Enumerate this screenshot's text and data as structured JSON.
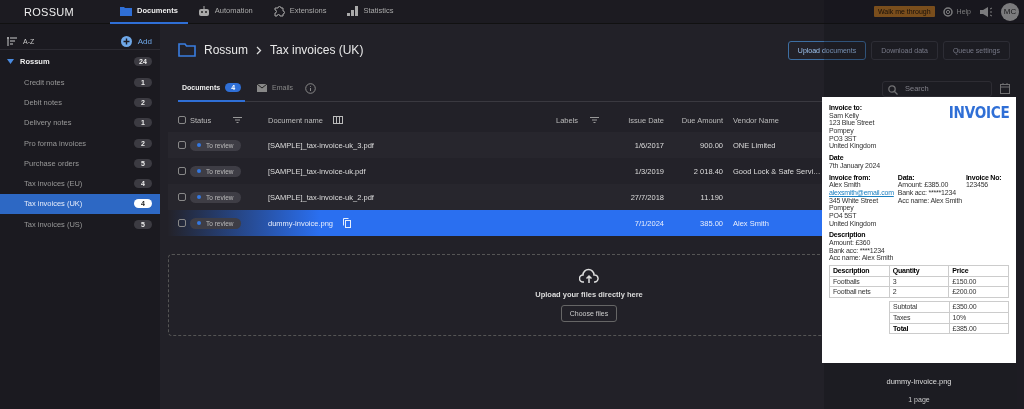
{
  "topbar": {
    "logo": "ROSSUM",
    "nav": [
      {
        "label": "Documents",
        "selected": true
      },
      {
        "label": "Automation",
        "selected": false
      },
      {
        "label": "Extensions",
        "selected": false
      },
      {
        "label": "Statistics",
        "selected": false
      }
    ],
    "walkthrough": "Walk me through",
    "help": "Help",
    "avatar": "MC"
  },
  "sidebar": {
    "sort": "A-Z",
    "add": "Add",
    "workspace": {
      "name": "Rossum",
      "count": "24",
      "expanded": true,
      "children": [
        {
          "label": "Credit notes",
          "count": "1",
          "selected": false
        },
        {
          "label": "Debit notes",
          "count": "2",
          "selected": false
        },
        {
          "label": "Delivery notes",
          "count": "1",
          "selected": false
        },
        {
          "label": "Pro forma invoices",
          "count": "2",
          "selected": false
        },
        {
          "label": "Purchase orders",
          "count": "5",
          "selected": false
        },
        {
          "label": "Tax invoices (EU)",
          "count": "4",
          "selected": false
        },
        {
          "label": "Tax invoices (UK)",
          "count": "4",
          "selected": true
        },
        {
          "label": "Tax invoices (US)",
          "count": "5",
          "selected": false
        }
      ]
    }
  },
  "header": {
    "breadcrumb": [
      "Rossum",
      "Tax invoices (UK)"
    ],
    "buttons": [
      {
        "label": "Upload documents",
        "kind": "primary"
      },
      {
        "label": "Download data",
        "kind": "secondary"
      },
      {
        "label": "Queue settings",
        "kind": "secondary"
      }
    ]
  },
  "tabs": [
    {
      "label": "Documents",
      "badge": "4",
      "selected": true
    },
    {
      "label": "Emails",
      "selected": false
    }
  ],
  "search": {
    "placeholder": "Search"
  },
  "table": {
    "all_checked": false,
    "columns": [
      "Status",
      "Document name",
      "Labels",
      "Issue Date",
      "Due Amount",
      "Vendor Name"
    ],
    "rows": [
      {
        "status": "To review",
        "name": "[SAMPLE]_tax-invoice-uk_3.pdf",
        "issue_date": "1/6/2017",
        "due_amount": "900.00",
        "vendor": "ONE Limited",
        "checked": false,
        "selected": false
      },
      {
        "status": "To review",
        "name": "[SAMPLE]_tax-invoice-uk.pdf",
        "issue_date": "1/3/2019",
        "due_amount": "2 018.40",
        "vendor": "Good Lock & Safe Servi…",
        "checked": false,
        "selected": false
      },
      {
        "status": "To review",
        "name": "[SAMPLE]_tax-invoice-uk_2.pdf",
        "issue_date": "27/7/2018",
        "due_amount": "11.190",
        "checked": false,
        "selected": false
      },
      {
        "status": "To review",
        "name": "dummy-invoice.png",
        "issue_date": "7/1/2024",
        "due_amount": "385.00",
        "vendor": "Alex Smith",
        "checked": false,
        "selected": true
      }
    ]
  },
  "upload": {
    "text": "Upload your files directly here",
    "button": "Choose files"
  },
  "preview": {
    "filename": "dummy-invoice.png",
    "pages": "1 page",
    "document": {
      "title": "INVOICE",
      "to": [
        "Invoice to:",
        "Sam Kelly",
        "123 Blue Street",
        "Pompey",
        "PO3 3ST",
        "United Kingdom"
      ],
      "date": [
        "Date",
        "7th January 2024"
      ],
      "from": [
        "Invoice from:",
        "Alex Smith",
        "alexsmith@email.com",
        "345 White Street",
        "Pompey",
        "PO4 5ST",
        "United Kingdom"
      ],
      "data": [
        "Data:",
        "Amount: £385.00",
        "Bank acc: *****1234",
        "Acc name: Alex Smith"
      ],
      "number": [
        "Invoice No:",
        "123456"
      ],
      "description": [
        "Description",
        "Amount: £360",
        "Bank acc: ****1234",
        "Acc name: Alex Smith"
      ],
      "items": [
        [
          "Description",
          "Quantity",
          "Price"
        ],
        [
          "Footballs",
          "3",
          "£150.00"
        ],
        [
          "Football nets",
          "2",
          "£200.00"
        ]
      ],
      "totals": [
        [
          "Subtotal",
          "£350.00"
        ],
        [
          "Taxes",
          "10%"
        ],
        [
          "Total",
          "£385.00"
        ]
      ]
    }
  }
}
